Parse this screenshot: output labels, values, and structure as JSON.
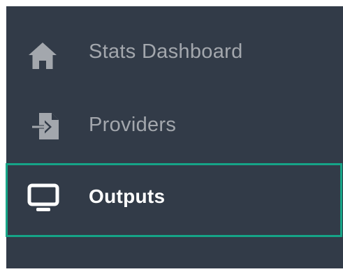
{
  "sidebar": {
    "items": [
      {
        "label": "Stats Dashboard",
        "icon": "home-icon",
        "active": false
      },
      {
        "label": "Providers",
        "icon": "file-import-icon",
        "active": false
      },
      {
        "label": "Outputs",
        "icon": "desktop-monitor-icon",
        "active": true
      }
    ]
  },
  "colors": {
    "sidebar_bg": "#323b48",
    "inactive_text": "#a3a7ad",
    "active_text": "#ffffff",
    "active_border": "#16a487"
  }
}
